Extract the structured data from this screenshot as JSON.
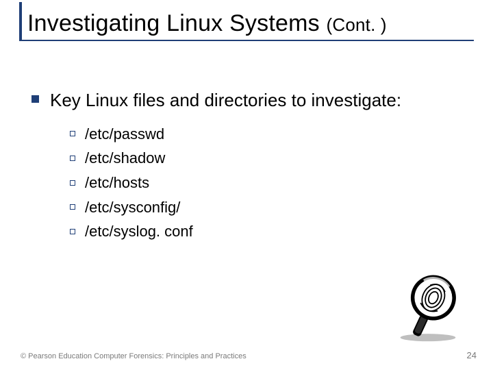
{
  "title": {
    "main": "Investigating Linux Systems",
    "cont": "(Cont. )"
  },
  "lead": "Key Linux files and directories to investigate:",
  "items": [
    "/etc/passwd",
    "/etc/shadow",
    "/etc/hosts",
    "/etc/sysconfig/",
    "/etc/syslog. conf"
  ],
  "footer": "© Pearson Education  Computer Forensics: Principles and Practices",
  "page": "24"
}
